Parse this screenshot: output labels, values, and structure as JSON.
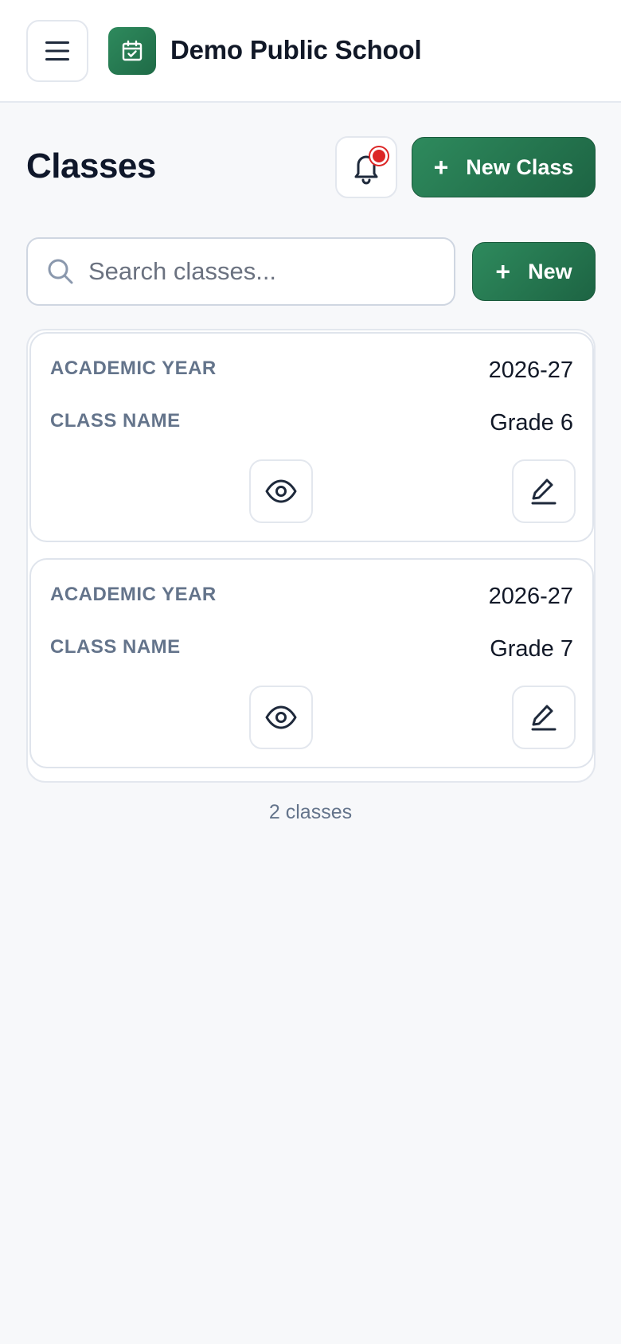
{
  "header": {
    "school_name": "Demo Public School",
    "menu_icon": "hamburger-menu-icon",
    "logo_icon": "calendar-check-icon",
    "logo_color": "#2e8a5d"
  },
  "page": {
    "title": "Classes",
    "notification_icon": "bell-icon",
    "notification_dot_color": "#dc2626",
    "new_class_button": "New Class",
    "new_button": "New",
    "plus": "+"
  },
  "search": {
    "placeholder": "Search classes...",
    "value": ""
  },
  "classes": [
    {
      "academic_year_label": "ACADEMIC YEAR",
      "academic_year": "2026-27",
      "class_name_label": "CLASS NAME",
      "class_name": "Grade 6"
    },
    {
      "academic_year_label": "ACADEMIC YEAR",
      "academic_year": "2026-27",
      "class_name_label": "CLASS NAME",
      "class_name": "Grade 7"
    }
  ],
  "footer": {
    "count_text": "2 classes"
  },
  "colors": {
    "accent": "#2e8a5d",
    "background": "#f7f8fa"
  }
}
